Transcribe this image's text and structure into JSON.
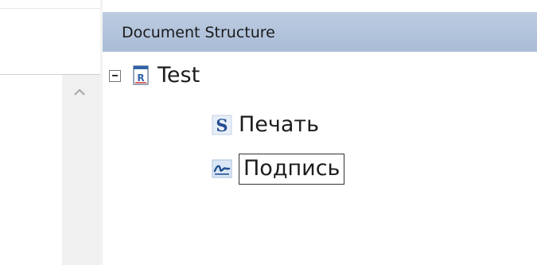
{
  "panel": {
    "title": "Document Structure"
  },
  "tree": {
    "root": {
      "label": "Test",
      "icon": "report-doc-icon",
      "expanded": true
    },
    "children": [
      {
        "label": "Печать",
        "icon": "stamp-s-icon"
      },
      {
        "label": "Подпись",
        "icon": "signature-icon",
        "selected": true
      }
    ]
  },
  "colors": {
    "header_bg": "#b4c5dd",
    "selection_border": "#333333",
    "scroll_track": "#f0f0f0"
  }
}
